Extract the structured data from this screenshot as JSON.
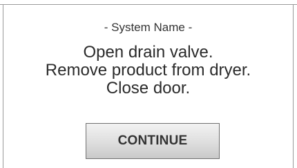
{
  "dialog": {
    "system_name": "- System Name -",
    "message_lines": [
      "Open drain valve.",
      "Remove product from dryer.",
      "Close door."
    ],
    "continue_label": "CONTINUE"
  }
}
